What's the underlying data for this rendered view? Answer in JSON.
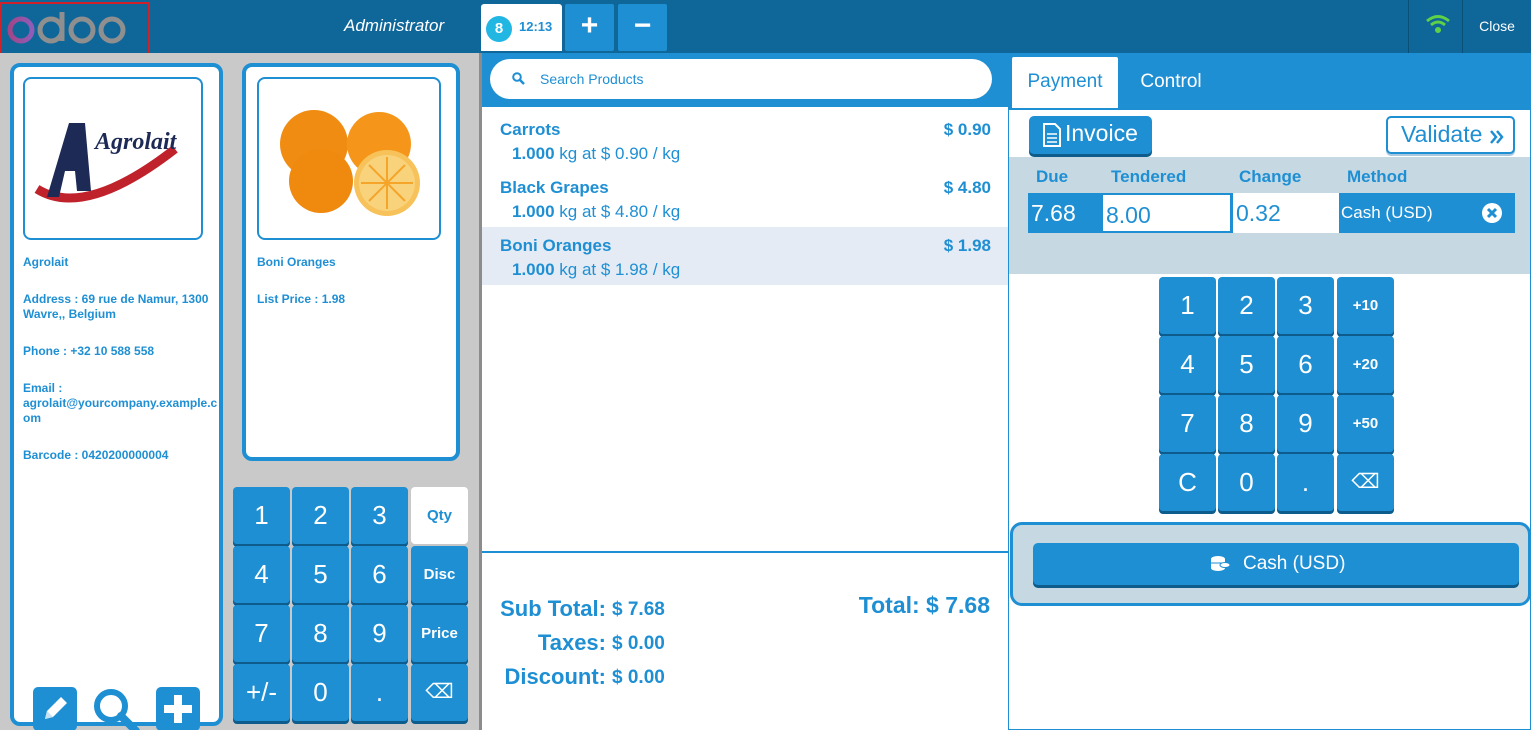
{
  "header": {
    "logo_text": "odoo",
    "cashier": "Administrator",
    "order_badge": "8",
    "order_time": "12:13",
    "add_order_label": "+",
    "remove_order_label": "−",
    "close_label": "Close"
  },
  "customer": {
    "logo_text": "Agrolait",
    "name": "Agrolait",
    "address": "Address : 69 rue de Namur, 1300 Wavre,, Belgium",
    "phone": "Phone : +32 10 588 558",
    "email_label": "Email :",
    "email": "agrolait@yourcompany.example.com",
    "barcode": "Barcode : 0420200000004"
  },
  "product": {
    "name": "Boni Oranges",
    "list_price": "List Price : 1.98"
  },
  "left_numpad": {
    "keys": [
      "1",
      "2",
      "3",
      "Qty",
      "4",
      "5",
      "6",
      "Disc",
      "7",
      "8",
      "9",
      "Price",
      "+/-",
      "0",
      ".",
      "⌫"
    ]
  },
  "search": {
    "placeholder": "Search Products"
  },
  "order_lines": [
    {
      "name": "Carrots",
      "price": "$ 0.90",
      "qty": "1.000",
      "detail": "kg at $ 0.90 / kg"
    },
    {
      "name": "Black Grapes",
      "price": "$ 4.80",
      "qty": "1.000",
      "detail": "kg at $ 4.80 / kg"
    },
    {
      "name": "Boni Oranges",
      "price": "$ 1.98",
      "qty": "1.000",
      "detail": "kg at $ 1.98 / kg"
    }
  ],
  "summary": {
    "subtotal_label": "Sub Total:",
    "subtotal": "$ 7.68",
    "taxes_label": "Taxes:",
    "taxes": "$ 0.00",
    "discount_label": "Discount:",
    "discount": "$ 0.00",
    "total": "Total: $ 7.68"
  },
  "payment": {
    "tabs": [
      "Payment",
      "Control"
    ],
    "invoice_label": "Invoice",
    "validate_label": "Validate",
    "columns": [
      "Due",
      "Tendered",
      "Change",
      "Method"
    ],
    "line": {
      "due": "7.68",
      "tendered": "8.00",
      "change": "0.32",
      "method": "Cash (USD)"
    },
    "numpad": [
      "1",
      "2",
      "3",
      "+10",
      "4",
      "5",
      "6",
      "+20",
      "7",
      "8",
      "9",
      "+50",
      "C",
      "0",
      ".",
      "⌫"
    ],
    "cash_button_label": "Cash (USD)"
  },
  "colors": {
    "primary": "#1f8fd3",
    "header": "#0e6699",
    "selected_line": "#e5ebf4",
    "payment_box": "#c6d9e3"
  }
}
